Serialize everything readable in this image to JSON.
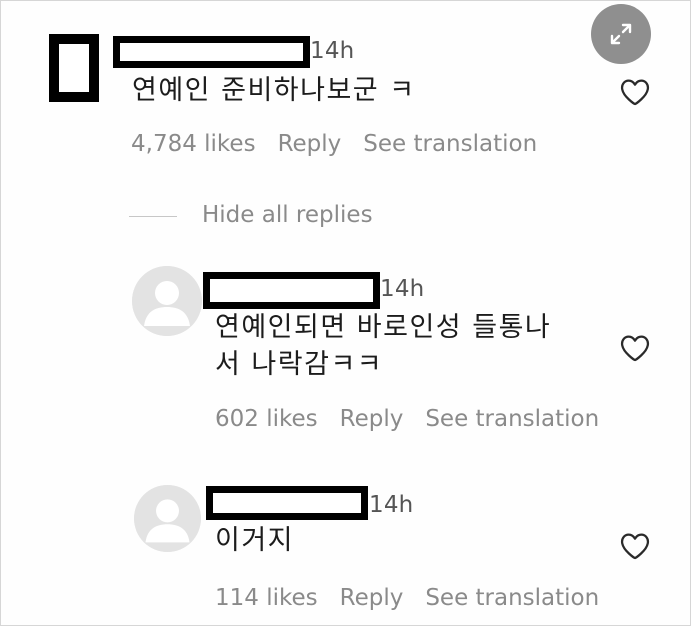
{
  "colors": {
    "background": "#ffffff",
    "text": "#1c1c1c",
    "secondary_text": "#8a8a8a",
    "expand_button": "#8f8f8f"
  },
  "overlay": {
    "expand_icon": "expand-arrows-icon"
  },
  "comment": {
    "time": "14h",
    "text": "연예인 준비하나보군 ㅋ",
    "likes": "4,784 likes",
    "reply": "Reply",
    "see_translation": "See translation"
  },
  "hide_replies": "Hide all replies",
  "replies": [
    {
      "time": "14h",
      "text_line1": "연예인되면 바로인성 들통나",
      "text_line2": "서 나락감ㅋㅋ",
      "likes": "602 likes",
      "reply": "Reply",
      "see_translation": "See translation"
    },
    {
      "time": "14h",
      "text_line1": "이거지",
      "likes": "114 likes",
      "reply": "Reply",
      "see_translation": "See translation"
    }
  ]
}
